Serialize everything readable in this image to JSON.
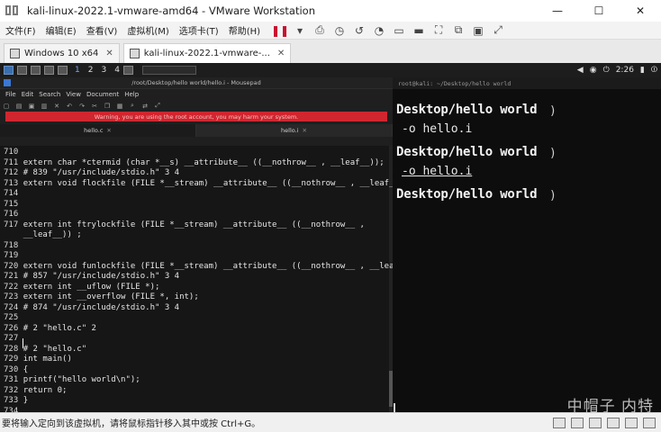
{
  "window": {
    "title": "kali-linux-2022.1-vmware-amd64 - VMware Workstation",
    "ctrl_minimize": "—",
    "ctrl_maximize": "☐",
    "ctrl_close": "✕"
  },
  "menu": {
    "items": [
      "文件(F)",
      "编辑(E)",
      "查看(V)",
      "虚拟机(M)",
      "选项卡(T)",
      "帮助(H)"
    ]
  },
  "tabs": [
    {
      "label": "Windows 10 x64",
      "close": "✕"
    },
    {
      "label": "kali-linux-2022.1-vmware-...",
      "close": "✕"
    }
  ],
  "kali_panel": {
    "workspaces": [
      "1",
      "2",
      "3",
      "4"
    ],
    "clock": "2:26"
  },
  "mousepad": {
    "title": "/root/Desktop/hello world/hello.i - Mousepad",
    "menu": [
      "File",
      "Edit",
      "Search",
      "View",
      "Document",
      "Help"
    ],
    "warning": "Warning, you are using the root account, you may harm your system.",
    "tabs": [
      {
        "label": "hello.c",
        "close": "✕"
      },
      {
        "label": "hello.i",
        "close": "✕"
      }
    ],
    "code_lines": [
      {
        "num": "710",
        "text": ""
      },
      {
        "num": "711",
        "text": "extern char *ctermid (char *__s) __attribute__ ((__nothrow__ , __leaf__));"
      },
      {
        "num": "712",
        "text": "# 839 \"/usr/include/stdio.h\" 3 4"
      },
      {
        "num": "713",
        "text": "extern void flockfile (FILE *__stream) __attribute__ ((__nothrow__ , __leaf__));"
      },
      {
        "num": "714",
        "text": ""
      },
      {
        "num": "715",
        "text": ""
      },
      {
        "num": "716",
        "text": ""
      },
      {
        "num": "717",
        "text": "extern int ftrylockfile (FILE *__stream) __attribute__ ((__nothrow__ ,"
      },
      {
        "num": "",
        "text": "__leaf__)) ;"
      },
      {
        "num": "718",
        "text": ""
      },
      {
        "num": "719",
        "text": ""
      },
      {
        "num": "720",
        "text": "extern void funlockfile (FILE *__stream) __attribute__ ((__nothrow__ , __leaf__));"
      },
      {
        "num": "721",
        "text": "# 857 \"/usr/include/stdio.h\" 3 4"
      },
      {
        "num": "722",
        "text": "extern int __uflow (FILE *);"
      },
      {
        "num": "723",
        "text": "extern int __overflow (FILE *, int);"
      },
      {
        "num": "724",
        "text": "# 874 \"/usr/include/stdio.h\" 3 4"
      },
      {
        "num": "725",
        "text": ""
      },
      {
        "num": "726",
        "text": "# 2 \"hello.c\" 2"
      },
      {
        "num": "727",
        "text": ""
      },
      {
        "num": "728",
        "text": "# 2 \"hello.c\""
      },
      {
        "num": "729",
        "text": "int main()"
      },
      {
        "num": "730",
        "text": "{"
      },
      {
        "num": "731",
        "text": "printf(\"hello world\\n\");"
      },
      {
        "num": "732",
        "text": "return 0;"
      },
      {
        "num": "733",
        "text": "}"
      },
      {
        "num": "734",
        "text": ""
      }
    ]
  },
  "terminal": {
    "title": "root@kali: ~/Desktop/hello world",
    "lines": [
      {
        "kind": "path",
        "text": "Desktop/hello world"
      },
      {
        "kind": "cmd",
        "text": "-o hello.i"
      },
      {
        "kind": "path",
        "text": "Desktop/hello world"
      },
      {
        "kind": "cmd",
        "text": "-o hello.i"
      },
      {
        "kind": "path",
        "text": "Desktop/hello world"
      }
    ]
  },
  "status": {
    "text": "要将输入定向到该虚拟机，请将鼠标指针移入其中或按 Ctrl+G。"
  },
  "watermark": "中帽子 内特"
}
